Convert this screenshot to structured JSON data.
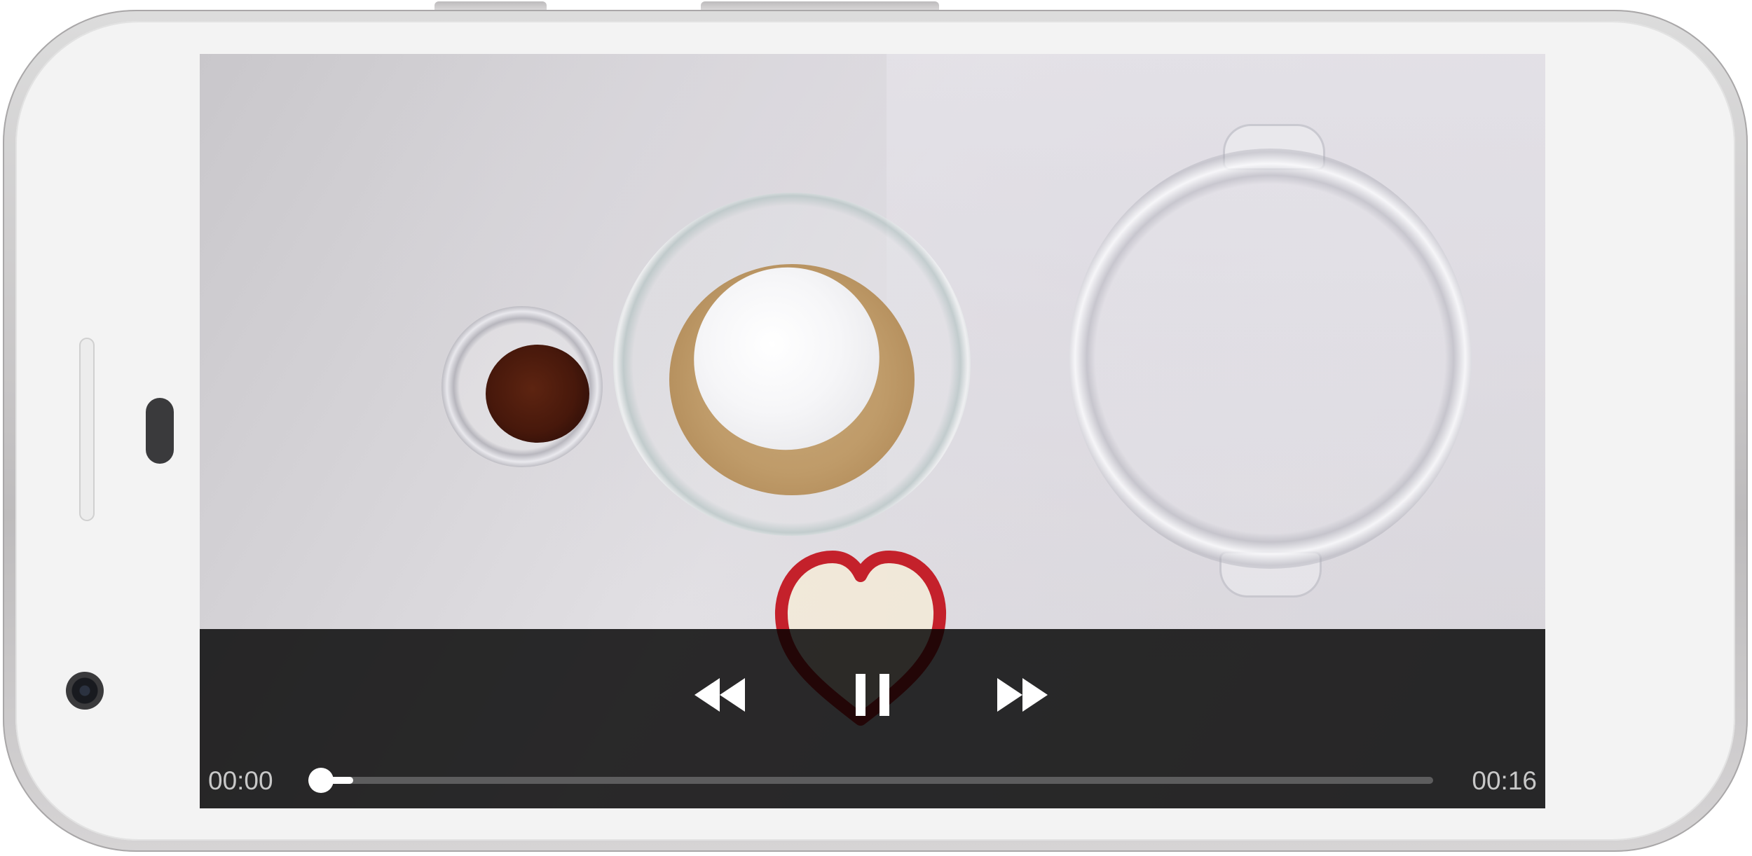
{
  "player": {
    "state": "paused",
    "elapsed": "00:00",
    "duration": "00:16",
    "progress_fraction": 0.04,
    "buffered_fraction": 0.04
  },
  "controls": {
    "rewind_icon": "rewind-icon",
    "pause_icon": "pause-icon",
    "fast_forward_icon": "fast-forward-icon"
  },
  "colors": {
    "control_bar": "#000000",
    "control_icon": "#ffffff",
    "time_text": "#c8c8c8",
    "seek_track": "#5d5d5e",
    "seek_progress": "#ffffff"
  }
}
